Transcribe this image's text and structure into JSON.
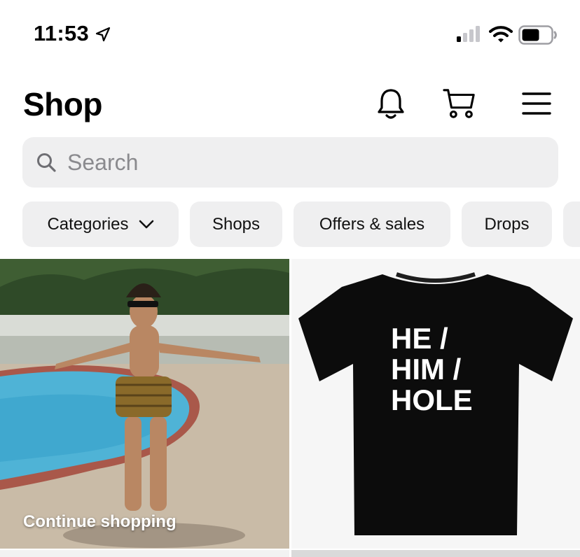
{
  "status_bar": {
    "time": "11:53",
    "location_icon": "location-arrow-icon",
    "signal_icon": "cellular-signal-icon",
    "wifi_icon": "wifi-icon",
    "battery_icon": "battery-icon"
  },
  "header": {
    "title": "Shop",
    "icons": [
      "bell-icon",
      "cart-icon",
      "menu-icon"
    ]
  },
  "search": {
    "placeholder": "Search",
    "icon": "search-icon"
  },
  "chips": [
    {
      "label": "Categories",
      "icon": "chevron-down-icon"
    },
    {
      "label": "Shops"
    },
    {
      "label": "Offers & sales"
    },
    {
      "label": "Drops"
    }
  ],
  "tiles": [
    {
      "caption": "Continue shopping"
    },
    {
      "shirt_text": [
        "HE /",
        "HIM /",
        "HOLE"
      ]
    }
  ],
  "colors": {
    "chip_bg": "#efeff0",
    "search_bg": "#efeff0",
    "placeholder": "#8a8a8e",
    "text": "#000000"
  }
}
